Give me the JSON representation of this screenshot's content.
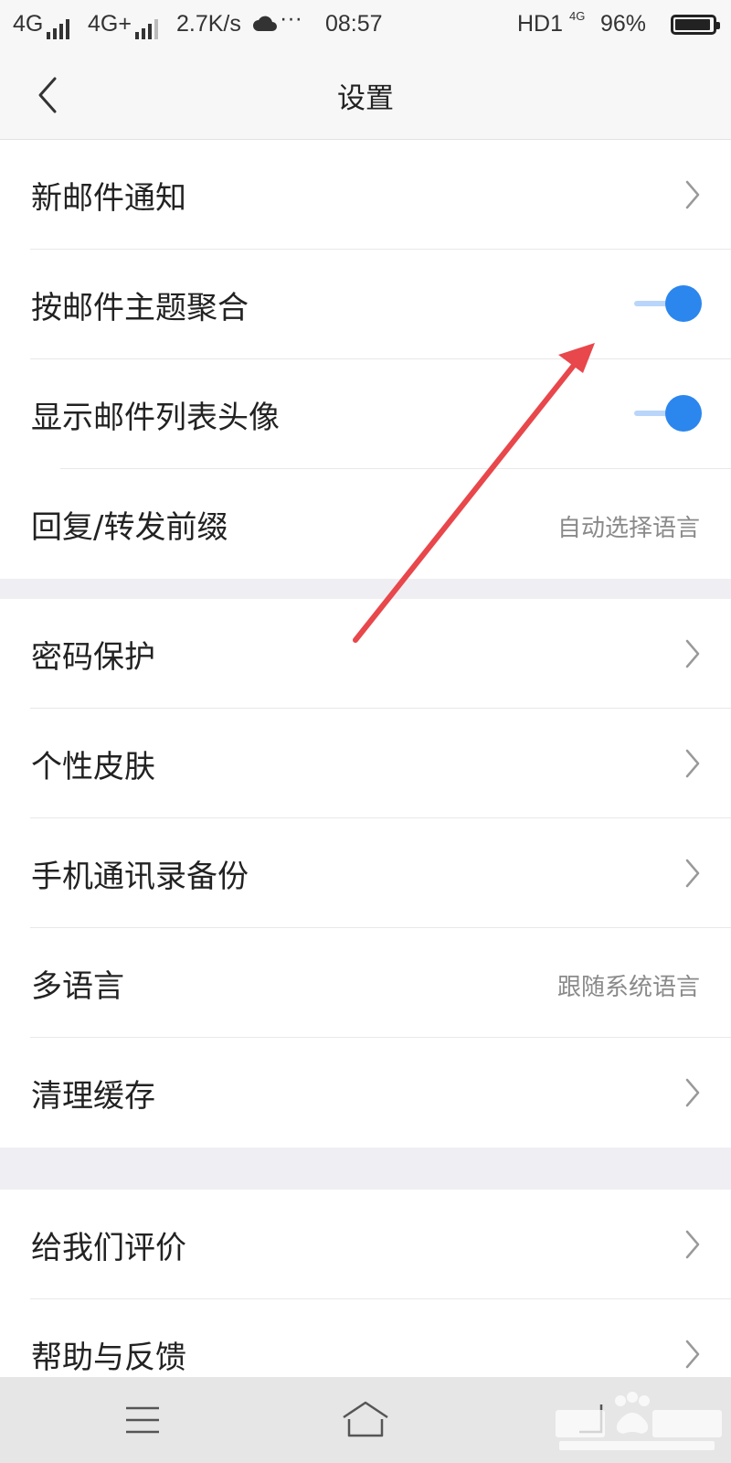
{
  "status_bar": {
    "network1": "4G",
    "network2": "4G+",
    "speed": "2.7K/s",
    "more": "···",
    "time": "08:57",
    "hd": "HD1",
    "net_small": "4G",
    "battery": "96%"
  },
  "header": {
    "title": "设置",
    "back_icon": "chevron-left-icon"
  },
  "sections": [
    [
      {
        "label": "新邮件通知",
        "type": "link"
      },
      {
        "label": "按邮件主题聚合",
        "type": "toggle",
        "on": true
      },
      {
        "label": "显示邮件列表头像",
        "type": "toggle",
        "on": true
      },
      {
        "label": "回复/转发前缀",
        "type": "value",
        "value": "自动选择语言"
      }
    ],
    [
      {
        "label": "密码保护",
        "type": "link"
      },
      {
        "label": "个性皮肤",
        "type": "link"
      },
      {
        "label": "手机通讯录备份",
        "type": "link"
      },
      {
        "label": "多语言",
        "type": "value",
        "value": "跟随系统语言"
      },
      {
        "label": "清理缓存",
        "type": "link"
      }
    ],
    [
      {
        "label": "给我们评价",
        "type": "link"
      },
      {
        "label": "帮助与反馈",
        "type": "link"
      }
    ]
  ],
  "bottom_nav": {
    "menu_icon": "menu-icon",
    "home_icon": "home-icon"
  },
  "annotation": {
    "color": "#e8474b"
  },
  "accent_color": "#2b86ee"
}
